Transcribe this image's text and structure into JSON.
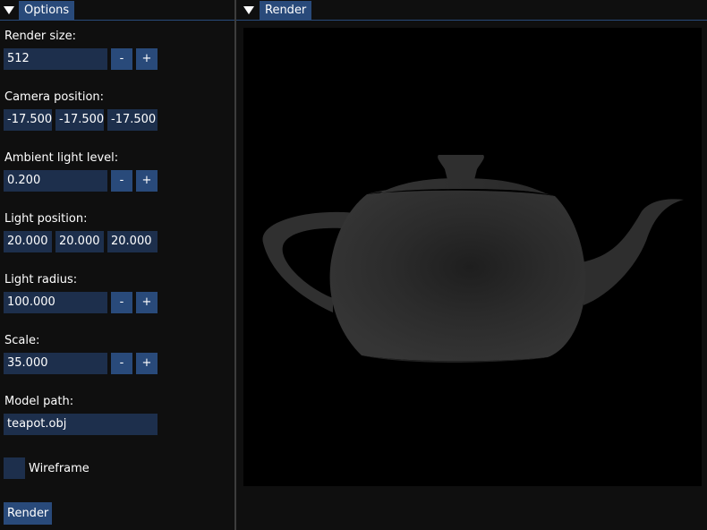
{
  "options": {
    "title": "Options",
    "render_size": {
      "label": "Render size:",
      "value": "512"
    },
    "camera_position": {
      "label": "Camera position:",
      "x": "-17.500",
      "y": "-17.500",
      "z": "-17.500"
    },
    "ambient_light": {
      "label": "Ambient light level:",
      "value": "0.200"
    },
    "light_position": {
      "label": "Light position:",
      "x": "20.000",
      "y": "20.000",
      "z": "20.000"
    },
    "light_radius": {
      "label": "Light radius:",
      "value": "100.000"
    },
    "scale": {
      "label": "Scale:",
      "value": "35.000"
    },
    "model_path": {
      "label": "Model path:",
      "value": "teapot.obj"
    },
    "wireframe": {
      "label": "Wireframe",
      "checked": false
    },
    "render_button": "Render",
    "minus": "-",
    "plus": "+"
  },
  "render": {
    "title": "Render",
    "image": "teapot-render"
  },
  "colors": {
    "accent": "#294a7a",
    "input_bg": "#1d2f4c",
    "background": "#0f0f0f"
  },
  "icons": {
    "collapse": "collapse-triangle-icon"
  }
}
